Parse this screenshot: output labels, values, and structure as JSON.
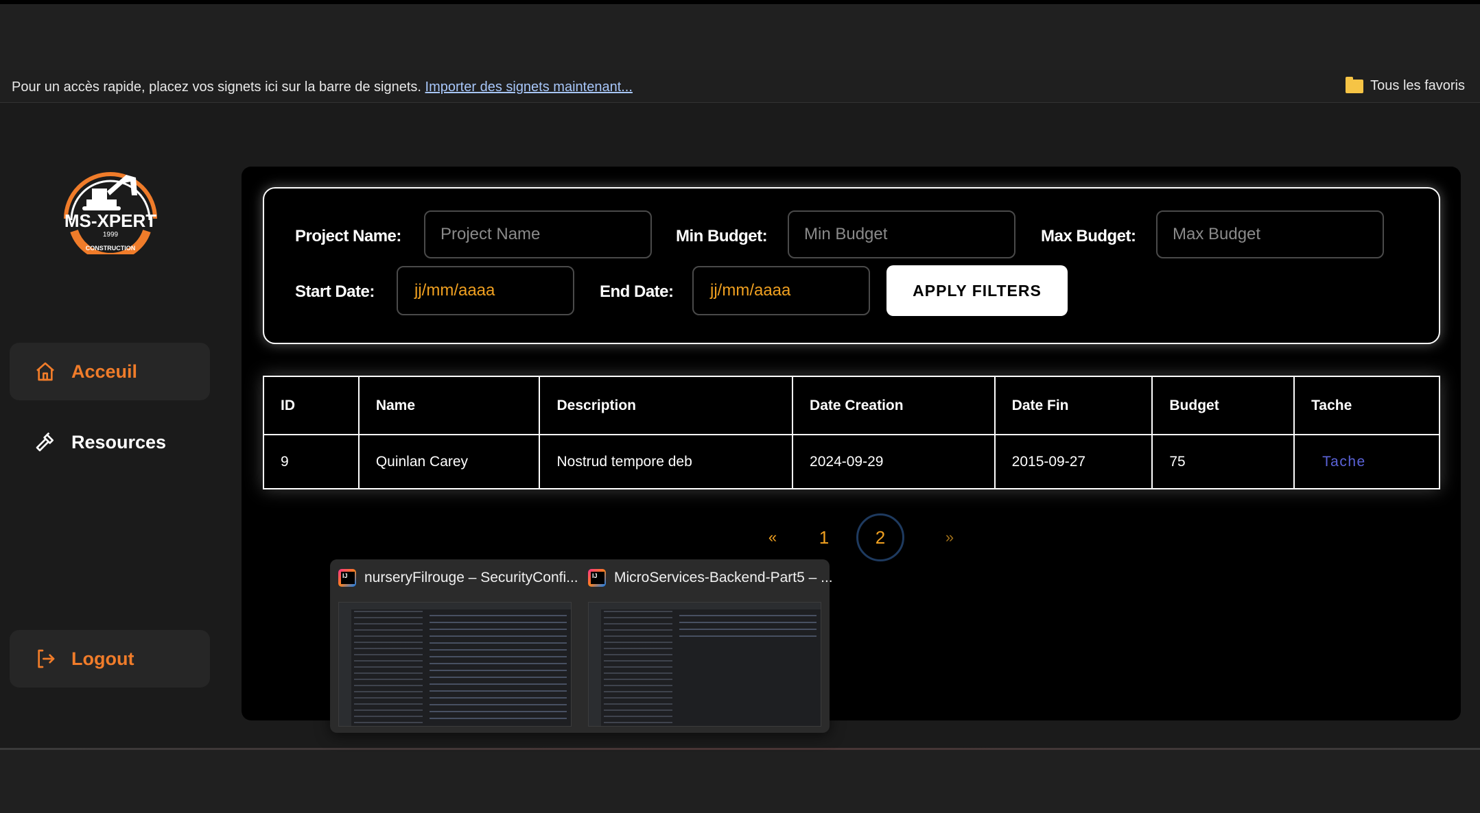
{
  "browser": {
    "bookmarks_message": "Pour un accès rapide, placez vos signets ici sur la barre de signets.",
    "bookmarks_link": "Importer des signets maintenant...",
    "all_favorites": "Tous les favoris"
  },
  "sidebar": {
    "logo_text": "MS-XPERT",
    "logo_year": "1999",
    "logo_sub": "CONSTRUCTION",
    "items": [
      {
        "label": "Acceuil",
        "icon": "home-icon"
      },
      {
        "label": "Resources",
        "icon": "hammer-icon"
      }
    ],
    "logout_label": "Logout"
  },
  "filters": {
    "project_name_label": "Project Name:",
    "project_name_placeholder": "Project Name",
    "project_name_value": "",
    "min_budget_label": "Min Budget:",
    "min_budget_placeholder": "Min Budget",
    "min_budget_value": "",
    "max_budget_label": "Max Budget:",
    "max_budget_placeholder": "Max Budget",
    "max_budget_value": "",
    "start_date_label": "Start Date:",
    "start_date_placeholder": "jj/mm/aaaa",
    "end_date_label": "End Date:",
    "end_date_placeholder": "jj/mm/aaaa",
    "apply_label": "APPLY FILTERS"
  },
  "table": {
    "columns": [
      "ID",
      "Name",
      "Description",
      "Date Creation",
      "Date Fin",
      "Budget",
      "Tache"
    ],
    "rows": [
      {
        "id": "9",
        "name": "Quinlan Carey",
        "description": "Nostrud tempore deb",
        "date_creation": "2024-09-29",
        "date_fin": "2015-09-27",
        "budget": "75",
        "tache": "Tache"
      }
    ]
  },
  "pagination": {
    "prev": "«",
    "pages": [
      "1",
      "2"
    ],
    "current": "2",
    "next": "»"
  },
  "taskbar_preview": {
    "windows": [
      {
        "title": "nurseryFilrouge – SecurityConfi..."
      },
      {
        "title": "MicroServices-Backend-Part5 – ..."
      }
    ]
  },
  "colors": {
    "accent": "#f07c2a",
    "page_link": "#f0a020",
    "tache_link": "#5b63d9",
    "panel_bg": "#000000",
    "sidebar_bg": "#1b1b1b"
  }
}
